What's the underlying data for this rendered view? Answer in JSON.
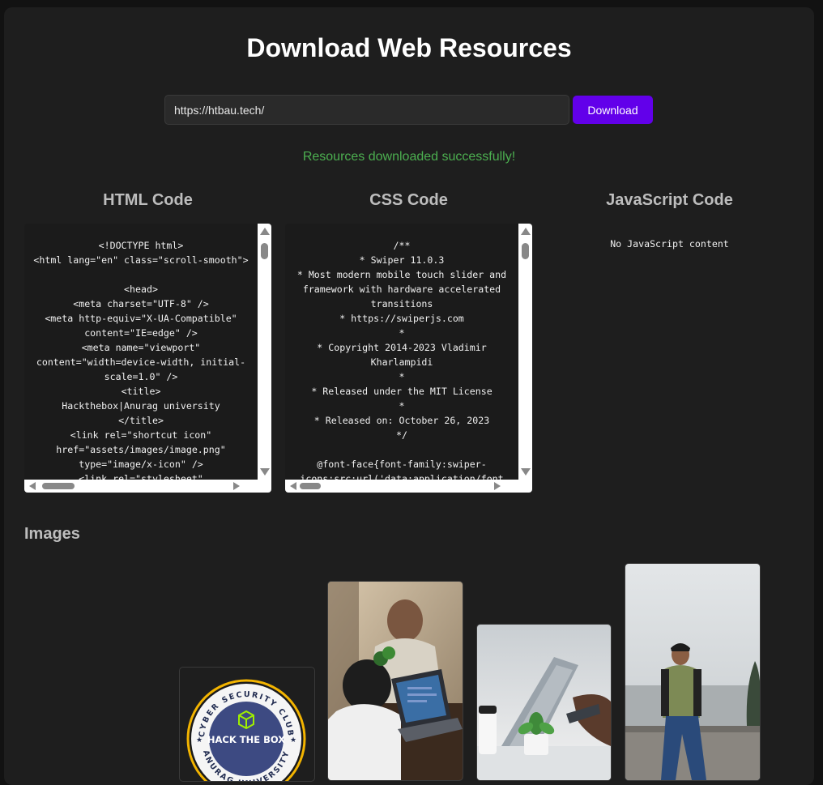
{
  "header": {
    "title": "Download Web Resources"
  },
  "search": {
    "value": "https://htbau.tech/",
    "button_label": "Download"
  },
  "status": {
    "message": "Resources downloaded successfully!"
  },
  "colors": {
    "accent": "#6200ea",
    "success": "#4caf50"
  },
  "sections": {
    "html": {
      "title": "HTML Code",
      "code": "<!DOCTYPE html>\n<html lang=\"en\" class=\"scroll-smooth\">\n\n<head>\n<meta charset=\"UTF-8\" />\n<meta http-equiv=\"X-UA-Compatible\" content=\"IE=edge\" />\n<meta name=\"viewport\" content=\"width=device-width, initial-scale=1.0\" />\n<title>\nHackthebox|Anurag university\n</title>\n<link rel=\"shortcut icon\" href=\"assets/images/image.png\" type=\"image/x-icon\" />\n<link rel=\"stylesheet\""
    },
    "css": {
      "title": "CSS Code",
      "code": "/**\n* Swiper 11.0.3\n* Most modern mobile touch slider and framework with hardware accelerated transitions\n* https://swiperjs.com\n*\n* Copyright 2014-2023 Vladimir Kharlampidi\n*\n* Released under the MIT License\n*\n* Released on: October 26, 2023\n*/\n\n@font-face{font-family:swiper-icons;src:url('data:application/font"
    },
    "js": {
      "title": "JavaScript Code",
      "code": "No JavaScript content"
    }
  },
  "images": {
    "title": "Images",
    "badge": {
      "ring_text": "CYBER SECURITY CLUB",
      "ring_text_bottom": "ANURAG UNIVERSITY",
      "label": "HACK THE BOX"
    },
    "icons": [
      "hack-the-box-cube-icon",
      "star-icon"
    ]
  }
}
